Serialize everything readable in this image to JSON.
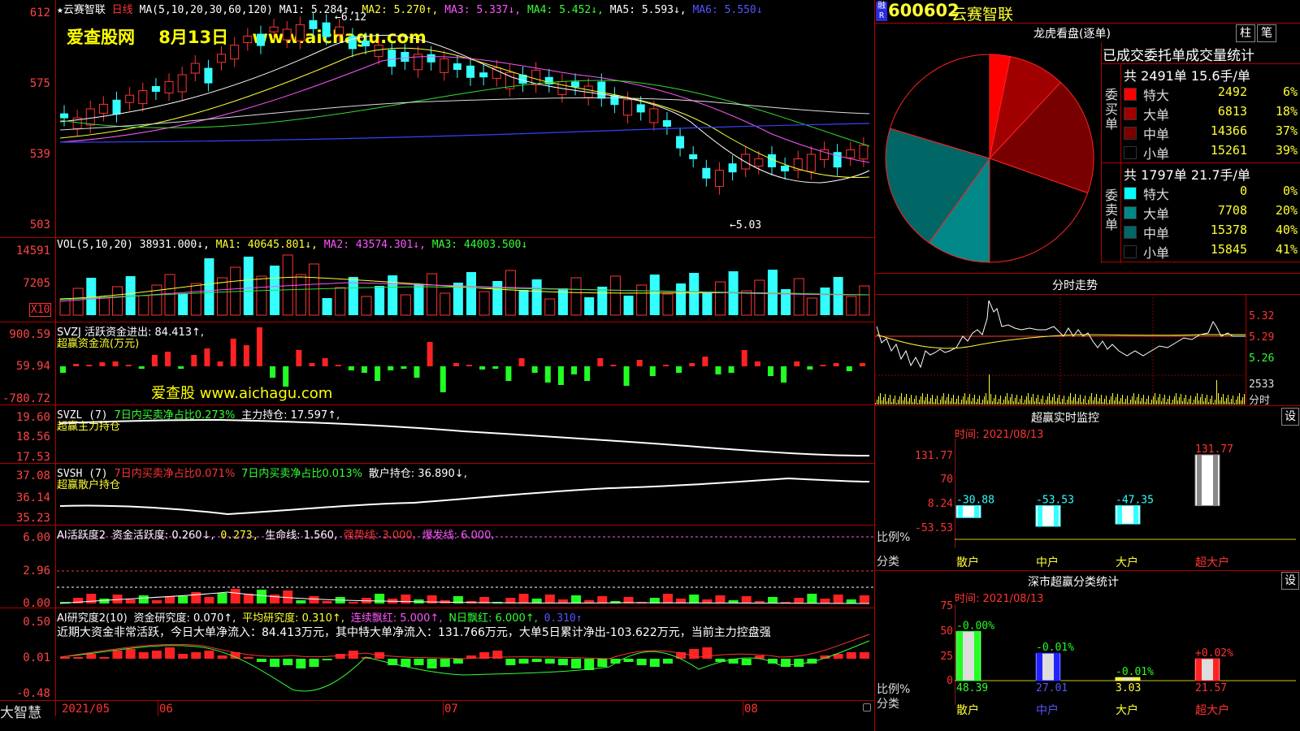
{
  "main": {
    "star": "★",
    "stock_name": "云赛智联",
    "period": "日线",
    "ma_label": "MA(5,10,20,30,60,120)",
    "ma1": "MA1: 5.284↑,",
    "ma2": "MA2: 5.270↑,",
    "ma3": "MA3: 5.337↓,",
    "ma4": "MA4: 5.452↓,",
    "ma5": "MA5: 5.593↓,",
    "ma6": "MA6: 5.550↓",
    "watermark": "爱查股网    8月13日    www.aichagu.com",
    "high_mark": "←6.12",
    "low_mark": "←5.03",
    "axis": [
      "612",
      "575",
      "539",
      "503"
    ]
  },
  "vol": {
    "label": "VOL(5,10,20)",
    "value": "38931.000↓,",
    "ma1": "MA1: 40645.801↓,",
    "ma2": "MA2: 43574.301↓,",
    "ma3": "MA3: 44003.500↓",
    "axis": [
      "14591",
      "7205"
    ],
    "unit": "X10"
  },
  "svzj": {
    "label": "SVZJ  活跃资金进出: 84.413↑,",
    "sub": "超赢资金流(万元)",
    "watermark": "爱查股 www.aichagu.com",
    "axis": [
      "900.59",
      "59.94",
      "-780.72"
    ]
  },
  "svzl": {
    "label": "SVZL (7)",
    "ratio": "7日内买卖净占比0.273%",
    "hold": "主力持仓: 17.597↑,",
    "sub": "超赢主力持仓",
    "axis": [
      "19.60",
      "18.56",
      "17.53"
    ]
  },
  "svsh": {
    "label": "SVSH (7)",
    "ratio1": "7日内买卖净占比0.071%",
    "ratio2": "7日内买卖净占比0.013%",
    "hold": "散户持仓: 36.890↓,",
    "sub": "超赢散户持仓",
    "axis": [
      "37.08",
      "36.14",
      "35.23"
    ]
  },
  "ai_active": {
    "label": "AI活跃度2",
    "a": "资金活跃度: 0.260↓,",
    "b": "0.273,",
    "c": "生命线: 1.560,",
    "d": "强势线: 3.000,",
    "e": "爆发线: 6.000,",
    "axis": [
      "6.00",
      "2.96",
      "0.00"
    ]
  },
  "ai_research": {
    "label": "AI研究度2(10)",
    "a": "资金研究度: 0.070↑,",
    "b": "平均研究度: 0.310↑,",
    "c": "连续飘红: 5.000↑,",
    "d": "N日飘红: 6.000↑,",
    "e": "0.310↑",
    "summary": "近期大资金非常活跃，今日大单净流入：84.413万元，其中特大单净流入：131.766万元，大单5日累计净出-103.622万元，当前主力控盘强",
    "axis": [
      "0.50",
      "0.01",
      "-0.48"
    ]
  },
  "bottom": {
    "brand": "大智慧",
    "dates": [
      "2021/05",
      "06",
      "07",
      "08"
    ]
  },
  "right": {
    "code": "600602",
    "name": "云赛智联",
    "badge": "融R",
    "dragon_title": "龙虎看盘(逐单)",
    "btn_zhu": "柱",
    "btn_bi": "笔",
    "stats_title": "已成交委托单成交量统计",
    "buy": {
      "side": "委买单",
      "summary": "共 2491单 15.6手/单",
      "rows": [
        {
          "name": "特大",
          "val": "2492",
          "pct": "6%",
          "color": "#ff0000"
        },
        {
          "name": "大单",
          "val": "6813",
          "pct": "18%",
          "color": "#a00000"
        },
        {
          "name": "中单",
          "val": "14366",
          "pct": "37%",
          "color": "#780000"
        },
        {
          "name": "小单",
          "val": "15261",
          "pct": "39%",
          "color": "#000000"
        }
      ]
    },
    "sell": {
      "side": "委卖单",
      "summary": "共 1797单 21.7手/单",
      "rows": [
        {
          "name": "特大",
          "val": "0",
          "pct": "0%",
          "color": "#00ffff"
        },
        {
          "name": "大单",
          "val": "7708",
          "pct": "20%",
          "color": "#008888"
        },
        {
          "name": "中单",
          "val": "15378",
          "pct": "40%",
          "color": "#006666"
        },
        {
          "name": "小单",
          "val": "15845",
          "pct": "41%",
          "color": "#000000"
        }
      ]
    },
    "intraday_title": "分时走势",
    "intraday_axis": [
      "5.32",
      "5.29",
      "5.26",
      "2533",
      "分时"
    ],
    "monitor": {
      "title": "超赢实时监控",
      "time": "时间: 2021/08/13",
      "btn": "设",
      "axis": [
        "131.77",
        "70",
        "8.24",
        "-53.53"
      ],
      "values": [
        "-30.88",
        "-53.53",
        "-47.35",
        "131.77"
      ],
      "ratio_label": "比例%",
      "cat_label": "分类",
      "cats": [
        "散户",
        "中户",
        "大户",
        "超大户"
      ]
    },
    "shenzhen": {
      "title": "深市超赢分类统计",
      "time": "时间: 2021/08/13",
      "btn": "设",
      "axis": [
        "75",
        "50",
        "25",
        "0"
      ],
      "changes": [
        "-0.00%",
        "-0.01%",
        "-0.01%",
        "+0.02%"
      ],
      "values": [
        "48.39",
        "27.01",
        "3.03",
        "21.57"
      ],
      "ratio_label": "比例%",
      "cat_label": "分类",
      "cats": [
        "散户",
        "中户",
        "大户",
        "超大户"
      ]
    }
  }
}
